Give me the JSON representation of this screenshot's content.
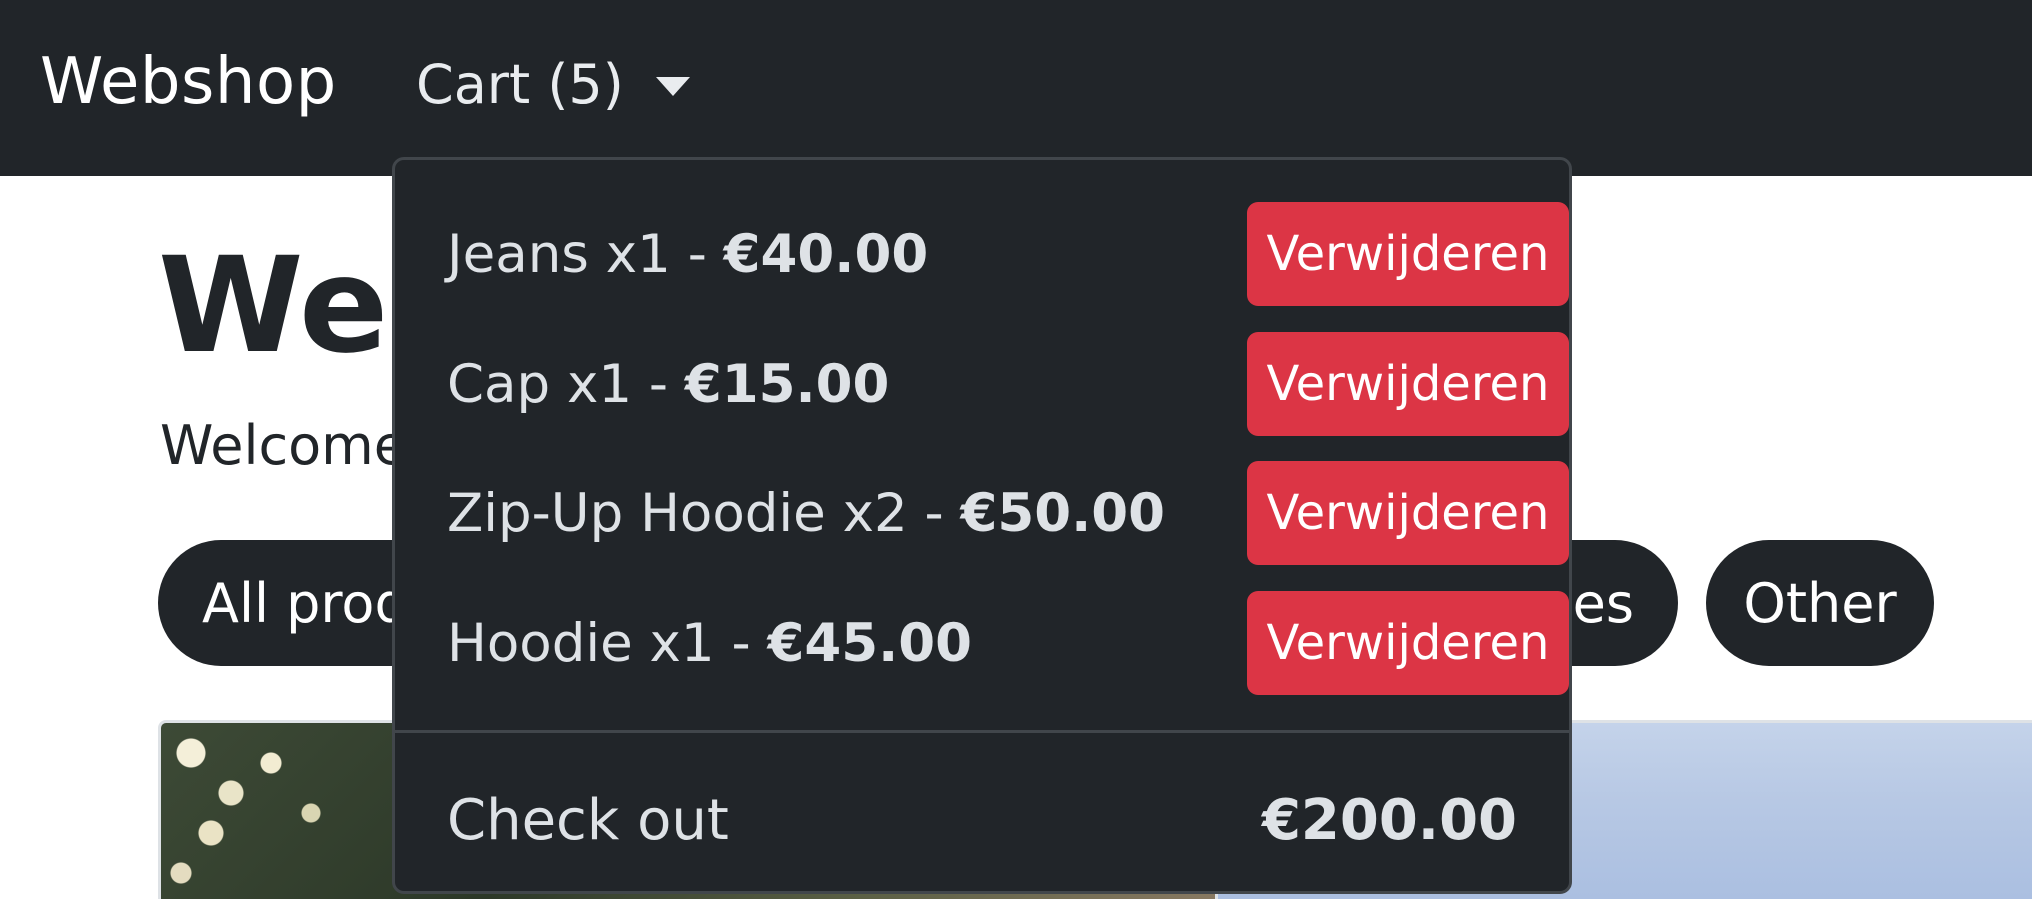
{
  "navbar": {
    "brand": "Webshop",
    "cart_label": "Cart (5)"
  },
  "page": {
    "title_visible": "Web",
    "welcome_visible": "Welcome"
  },
  "categories": {
    "all_products_visible": "All prod",
    "partial_visible": "ies",
    "other": "Other"
  },
  "cart": {
    "items": [
      {
        "name": "Jeans x1 - ",
        "price": "€40.00",
        "remove_label": "Verwijderen"
      },
      {
        "name": "Cap x1 - ",
        "price": "€15.00",
        "remove_label": "Verwijderen"
      },
      {
        "name": "Zip-Up Hoodie x2 - ",
        "price": "€50.00",
        "remove_label": "Verwijderen"
      },
      {
        "name": "Hoodie x1 - ",
        "price": "€45.00",
        "remove_label": "Verwijderen"
      }
    ],
    "checkout_label": "Check out",
    "total": "€200.00"
  },
  "colors": {
    "navbar_bg": "#212529",
    "danger": "#dc3545",
    "dropdown_text": "#dee2e6"
  }
}
